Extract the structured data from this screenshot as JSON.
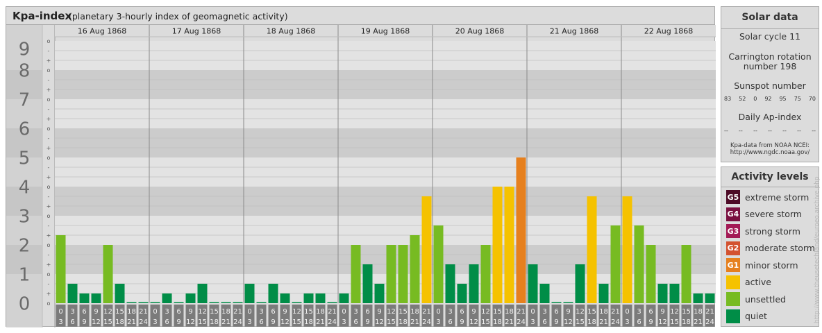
{
  "header": {
    "title": "Kpa-index",
    "subtitle": "(planetary 3-hourly index of geomagnetic activity)"
  },
  "chart_data": {
    "type": "bar",
    "title": "Kpa-index",
    "subtitle": "(planetary 3-hourly index of geomagnetic activity)",
    "ylim": [
      0,
      9
    ],
    "y_major_ticks": [
      "0",
      "1",
      "2",
      "3",
      "4",
      "5",
      "6",
      "7",
      "8",
      "9"
    ],
    "y_minor_ticks": [
      "o",
      "+",
      "-"
    ],
    "days": [
      "16 Aug 1868",
      "17 Aug 1868",
      "18 Aug 1868",
      "19 Aug 1868",
      "20 Aug 1868",
      "21 Aug 1868",
      "22 Aug 1868"
    ],
    "interval_start_labels": [
      "0",
      "3",
      "6",
      "9",
      "12",
      "15",
      "18",
      "21"
    ],
    "interval_end_labels": [
      "3",
      "6",
      "9",
      "12",
      "15",
      "18",
      "21",
      "24"
    ],
    "values": [
      [
        2.333,
        0.667,
        0.333,
        0.333,
        2.0,
        0.667,
        0.0,
        0.0
      ],
      [
        0.0,
        0.333,
        0.0,
        0.333,
        0.667,
        0.0,
        0.0,
        0.0
      ],
      [
        0.667,
        0.0,
        0.667,
        0.333,
        0.0,
        0.333,
        0.333,
        0.0
      ],
      [
        0.333,
        2.0,
        1.333,
        0.667,
        2.0,
        2.0,
        2.333,
        3.667
      ],
      [
        2.667,
        1.333,
        0.667,
        1.333,
        2.0,
        4.0,
        4.0,
        5.0
      ],
      [
        1.333,
        0.667,
        0.0,
        0.0,
        1.333,
        3.667,
        0.667,
        2.667
      ],
      [
        3.667,
        2.667,
        2.0,
        0.667,
        0.667,
        2.0,
        0.333,
        0.333
      ]
    ],
    "levels": [
      [
        3,
        1,
        1,
        1,
        3,
        1,
        1,
        1
      ],
      [
        1,
        1,
        1,
        1,
        1,
        1,
        1,
        1
      ],
      [
        1,
        1,
        1,
        1,
        1,
        1,
        1,
        1
      ],
      [
        1,
        3,
        1,
        1,
        3,
        3,
        3,
        4
      ],
      [
        3,
        1,
        1,
        1,
        3,
        4,
        4,
        5
      ],
      [
        1,
        1,
        1,
        1,
        1,
        4,
        1,
        3
      ],
      [
        4,
        3,
        3,
        1,
        1,
        3,
        1,
        1
      ]
    ],
    "colors": {
      "quiet": "#008d47",
      "unsettled": "#77bb22",
      "active": "#f5c200",
      "minor_storm": "#e6801e",
      "moderate_storm": "#d35230",
      "strong_storm": "#a31a55",
      "severe_storm": "#7a1040",
      "extreme_storm": "#4d0a26"
    },
    "grid": true,
    "legend_position": "right"
  },
  "solar": {
    "title": "Solar data",
    "cycle": "Solar cycle 11",
    "rotation_line1": "Carrington rotation",
    "rotation_line2": "number 198",
    "sunspot_label": "Sunspot number",
    "sunspot_values": [
      "83",
      "52",
      "0",
      "92",
      "95",
      "75",
      "70"
    ],
    "ap_label": "Daily Ap-index",
    "ap_values": [
      "--",
      "--",
      "--",
      "--",
      "--",
      "--",
      "--"
    ],
    "source_line1": "Kpa-data from NOAA NCEI:",
    "source_line2": "http://www.ngdc.noaa.gov/"
  },
  "legend": {
    "title": "Activity levels",
    "items": [
      {
        "code": "G5",
        "label": "extreme storm",
        "color": "#4d0a26"
      },
      {
        "code": "G4",
        "label": "severe storm",
        "color": "#7a1040"
      },
      {
        "code": "G3",
        "label": "strong storm",
        "color": "#a31a55"
      },
      {
        "code": "G2",
        "label": "moderate storm",
        "color": "#d35230"
      },
      {
        "code": "G1",
        "label": "minor storm",
        "color": "#e6801e"
      },
      {
        "code": "",
        "label": "active",
        "color": "#f5c200"
      },
      {
        "code": "",
        "label": "unsettled",
        "color": "#77bb22"
      },
      {
        "code": "",
        "label": "quiet",
        "color": "#008d47"
      }
    ]
  },
  "credit": "http://www.theusetechland/euroeo.archive.php"
}
